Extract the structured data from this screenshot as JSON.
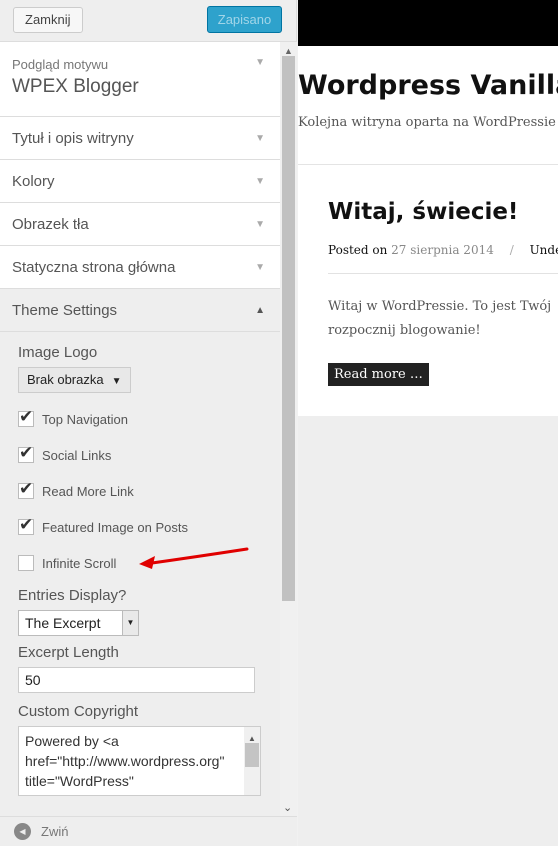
{
  "topbar": {
    "close_label": "Zamknij",
    "save_label": "Zapisano"
  },
  "theme_preview": {
    "small_label": "Podgląd motywu",
    "theme_name": "WPEX Blogger"
  },
  "sections": [
    {
      "label": "Tytuł i opis witryny"
    },
    {
      "label": "Kolory"
    },
    {
      "label": "Obrazek tła"
    },
    {
      "label": "Statyczna strona główna"
    },
    {
      "label": "Theme Settings"
    }
  ],
  "settings": {
    "image_logo_label": "Image Logo",
    "image_logo_button": "Brak obrazka",
    "checkboxes": [
      {
        "label": "Top Navigation",
        "checked": true
      },
      {
        "label": "Social Links",
        "checked": true
      },
      {
        "label": "Read More Link",
        "checked": true
      },
      {
        "label": "Featured Image on Posts",
        "checked": true
      },
      {
        "label": "Infinite Scroll",
        "checked": false
      }
    ],
    "entries_display_label": "Entries Display?",
    "entries_display_value": "The Excerpt",
    "excerpt_length_label": "Excerpt Length",
    "excerpt_length_value": "50",
    "custom_copyright_label": "Custom Copyright",
    "custom_copyright_value": "Powered by <a href=\"http://www.wordpress.org\" title=\"WordPress\""
  },
  "bottombar": {
    "collapse_label": "Zwiń"
  },
  "site": {
    "title": "Wordpress Vanilla",
    "description": "Kolejna witryna oparta na WordPressie",
    "post": {
      "title": "Witaj, świecie!",
      "meta_prefix": "Posted on",
      "date": "27 sierpnia 2014",
      "meta_sep": "/",
      "meta_after": "Under",
      "body_line1": "Witaj w WordPressie. To jest Twój",
      "body_line2": "rozpocznij blogowanie!",
      "read_more": "Read more …"
    }
  },
  "colors": {
    "primary_button": "#2ea2cc",
    "annotation_arrow": "#e00000"
  }
}
